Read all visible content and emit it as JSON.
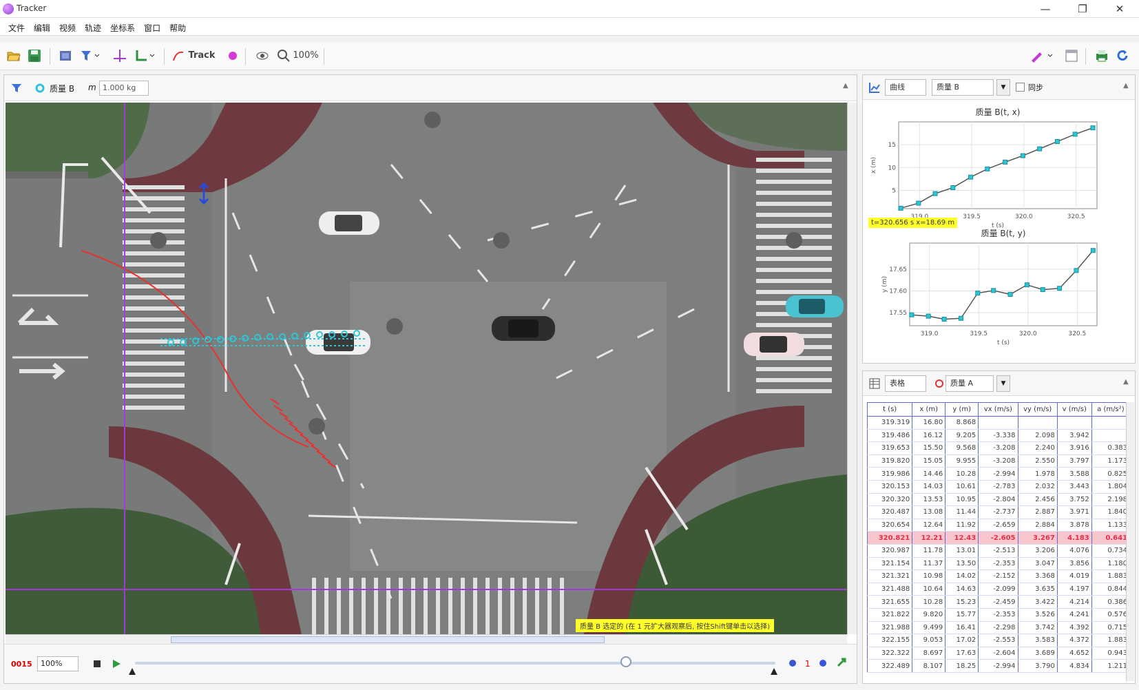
{
  "window": {
    "title": "Tracker",
    "controls": [
      "—",
      "❐",
      "✕"
    ]
  },
  "menubar": {
    "items": [
      "文件",
      "编辑",
      "视频",
      "轨迹",
      "坐标系",
      "窗口",
      "帮助"
    ]
  },
  "toolbar": {
    "track_label": "Track",
    "zoom": "100%"
  },
  "video_panel": {
    "track_name": "质量 B",
    "mass_label": "m",
    "mass_value": "1.000 kg",
    "hint": "质量 B 选定的 (在 1 元扩大器观察后, 按住Shift键单击以选择)",
    "frame": "0015",
    "rate": "100%"
  },
  "plot_panel": {
    "view_label": "曲线",
    "track_label": "质量 B",
    "checkbox_label": "同步",
    "plot1_title": "质量 B(t, x)",
    "plot2_title": "质量 B(t, y)",
    "readout": "t=320.656 s  x=18.69 m",
    "plot1_xlabel": "t (s)",
    "plot1_ylabel": "x (m)",
    "plot2_xlabel": "t (s)",
    "plot2_ylabel": "y (m)"
  },
  "table_panel": {
    "view_label": "表格",
    "track_label": "质量 A",
    "columns": [
      "t (s)",
      "x (m)",
      "y (m)",
      "vx (m/s)",
      "vy (m/s)",
      "v (m/s)",
      "a (m/s²)"
    ],
    "rows": [
      [
        "319.319",
        "16.80",
        "8.868",
        "",
        "",
        "",
        ""
      ],
      [
        "319.486",
        "16.12",
        "9.205",
        "-3.338",
        "2.098",
        "3.942",
        ""
      ],
      [
        "319.653",
        "15.50",
        "9.568",
        "-3.208",
        "2.240",
        "3.916",
        "0.383"
      ],
      [
        "319.820",
        "15.05",
        "9.955",
        "-3.208",
        "2.550",
        "3.797",
        "1.173"
      ],
      [
        "319.986",
        "14.46",
        "10.28",
        "-2.994",
        "1.978",
        "3.588",
        "0.825"
      ],
      [
        "320.153",
        "14.03",
        "10.61",
        "-2.783",
        "2.032",
        "3.443",
        "1.804"
      ],
      [
        "320.320",
        "13.53",
        "10.95",
        "-2.804",
        "2.456",
        "3.752",
        "2.198"
      ],
      [
        "320.487",
        "13.08",
        "11.44",
        "-2.737",
        "2.887",
        "3.971",
        "1.840"
      ],
      [
        "320.654",
        "12.64",
        "11.92",
        "-2.659",
        "2.884",
        "3.878",
        "1.133"
      ],
      [
        "320.821",
        "12.21",
        "12.43",
        "-2.605",
        "3.267",
        "4.183",
        "0.641"
      ],
      [
        "320.987",
        "11.78",
        "13.01",
        "-2.513",
        "3.206",
        "4.076",
        "0.734"
      ],
      [
        "321.154",
        "11.37",
        "13.50",
        "-2.353",
        "3.047",
        "3.856",
        "1.180"
      ],
      [
        "321.321",
        "10.98",
        "14.02",
        "-2.152",
        "3.368",
        "4.019",
        "1.883"
      ],
      [
        "321.488",
        "10.64",
        "14.63",
        "-2.099",
        "3.635",
        "4.197",
        "0.844"
      ],
      [
        "321.655",
        "10.28",
        "15.23",
        "-2.459",
        "3.422",
        "4.214",
        "0.386"
      ],
      [
        "321.822",
        "9.820",
        "15.77",
        "-2.353",
        "3.526",
        "4.241",
        "0.576"
      ],
      [
        "321.988",
        "9.499",
        "16.41",
        "-2.298",
        "3.742",
        "4.392",
        "0.715"
      ],
      [
        "322.155",
        "9.053",
        "17.02",
        "-2.553",
        "3.583",
        "4.372",
        "1.883"
      ],
      [
        "322.322",
        "8.697",
        "17.63",
        "-2.604",
        "3.689",
        "4.652",
        "0.943"
      ],
      [
        "322.489",
        "8.107",
        "18.25",
        "-2.994",
        "3.790",
        "4.834",
        "1.211"
      ]
    ],
    "selected_row": 9
  },
  "chart_data": [
    {
      "type": "line",
      "title": "质量 B(t, x)",
      "xlabel": "t (s)",
      "ylabel": "x (m)",
      "xlim": [
        318.8,
        320.7
      ],
      "ylim": [
        1,
        20
      ],
      "xticks": [
        "319.0",
        "319.5",
        "320.0",
        "320.5"
      ],
      "yticks": [
        "5",
        "10",
        "15"
      ],
      "x": [
        318.82,
        318.99,
        319.15,
        319.32,
        319.49,
        319.65,
        319.82,
        319.99,
        320.15,
        320.32,
        320.49,
        320.66
      ],
      "y": [
        1.1,
        2.2,
        4.3,
        5.6,
        7.9,
        9.7,
        11.2,
        12.6,
        14.1,
        15.7,
        17.3,
        18.7
      ]
    },
    {
      "type": "line",
      "title": "质量 B(t, y)",
      "xlabel": "t (s)",
      "ylabel": "y (m)",
      "xlim": [
        318.8,
        320.7
      ],
      "ylim": [
        17.52,
        17.71
      ],
      "xticks": [
        "319.0",
        "319.5",
        "320.0",
        "320.5"
      ],
      "yticks": [
        "17.55",
        "17.60",
        "17.65"
      ],
      "x": [
        318.82,
        318.99,
        319.15,
        319.32,
        319.49,
        319.65,
        319.82,
        319.99,
        320.15,
        320.32,
        320.49,
        320.66
      ],
      "y": [
        17.545,
        17.542,
        17.535,
        17.537,
        17.595,
        17.601,
        17.592,
        17.614,
        17.603,
        17.606,
        17.647,
        17.693
      ]
    }
  ],
  "colors": {
    "accent": "#a23cd6",
    "track_red": "#e83030",
    "track_cyan": "#2cc6d6",
    "highlight_yellow": "#ffff2a",
    "selection": "#f7c5cc"
  },
  "icons": [
    "open-icon",
    "save-icon",
    "clip-icon",
    "filter-icon",
    "axes-icon",
    "tape-icon",
    "track-icon",
    "point-icon",
    "eye-icon",
    "zoom-icon",
    "pen-icon",
    "window-icon",
    "print-icon",
    "refresh-icon"
  ]
}
